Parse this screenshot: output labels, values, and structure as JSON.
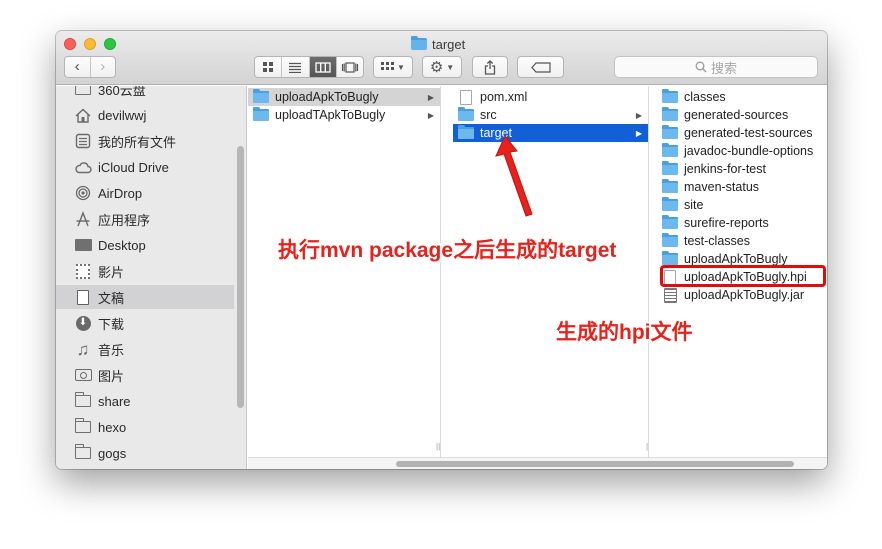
{
  "window": {
    "title": "target"
  },
  "toolbar": {
    "back_glyph": "‹",
    "forward_glyph": "›",
    "search_placeholder": "搜索",
    "icons": {
      "view_icon": "icon-grid",
      "view_list": "list-lines",
      "view_column": "column-bars",
      "view_coverflow": "coverflow",
      "arrange": "grid-dropdown",
      "action": "gear",
      "share": "share-box-arrow",
      "tag": "tag"
    }
  },
  "sidebar": {
    "items": [
      {
        "label": "360云盘",
        "icon": "folder-icon"
      },
      {
        "label": "devilwwj",
        "icon": "home-icon"
      },
      {
        "label": "我的所有文件",
        "icon": "all-files-icon"
      },
      {
        "label": "iCloud Drive",
        "icon": "cloud-icon"
      },
      {
        "label": "AirDrop",
        "icon": "airdrop-icon"
      },
      {
        "label": "应用程序",
        "icon": "applications-icon"
      },
      {
        "label": "Desktop",
        "icon": "desktop-icon"
      },
      {
        "label": "影片",
        "icon": "film-icon"
      },
      {
        "label": "文稿",
        "icon": "document-icon"
      },
      {
        "label": "下载",
        "icon": "download-icon"
      },
      {
        "label": "音乐",
        "icon": "music-icon"
      },
      {
        "label": "图片",
        "icon": "camera-icon"
      },
      {
        "label": "share",
        "icon": "folder-icon"
      },
      {
        "label": "hexo",
        "icon": "folder-icon"
      },
      {
        "label": "gogs",
        "icon": "folder-icon"
      }
    ]
  },
  "columns": {
    "col1": [
      {
        "name": "uploadApkToBugly",
        "type": "folder"
      },
      {
        "name": "uploadTApkToBugly",
        "type": "folder"
      }
    ],
    "col2": [
      {
        "name": "pom.xml",
        "type": "file"
      },
      {
        "name": "src",
        "type": "folder"
      },
      {
        "name": "target",
        "type": "folder"
      }
    ],
    "col3": [
      {
        "name": "classes",
        "type": "folder"
      },
      {
        "name": "generated-sources",
        "type": "folder"
      },
      {
        "name": "generated-test-sources",
        "type": "folder"
      },
      {
        "name": "javadoc-bundle-options",
        "type": "folder"
      },
      {
        "name": "jenkins-for-test",
        "type": "folder"
      },
      {
        "name": "maven-status",
        "type": "folder"
      },
      {
        "name": "site",
        "type": "folder"
      },
      {
        "name": "surefire-reports",
        "type": "folder"
      },
      {
        "name": "test-classes",
        "type": "folder"
      },
      {
        "name": "uploadApkToBugly",
        "type": "folder"
      },
      {
        "name": "uploadApkToBugly.hpi",
        "type": "file"
      },
      {
        "name": "uploadApkToBugly.jar",
        "type": "jar"
      }
    ]
  },
  "annotations": {
    "target_note": "执行mvn package之后生成的target",
    "hpi_note": "生成的hpi文件"
  },
  "colors": {
    "selection_blue": "#1160d6",
    "annotation_red": "#e8211b",
    "folder_blue": "#6cb9f0"
  }
}
